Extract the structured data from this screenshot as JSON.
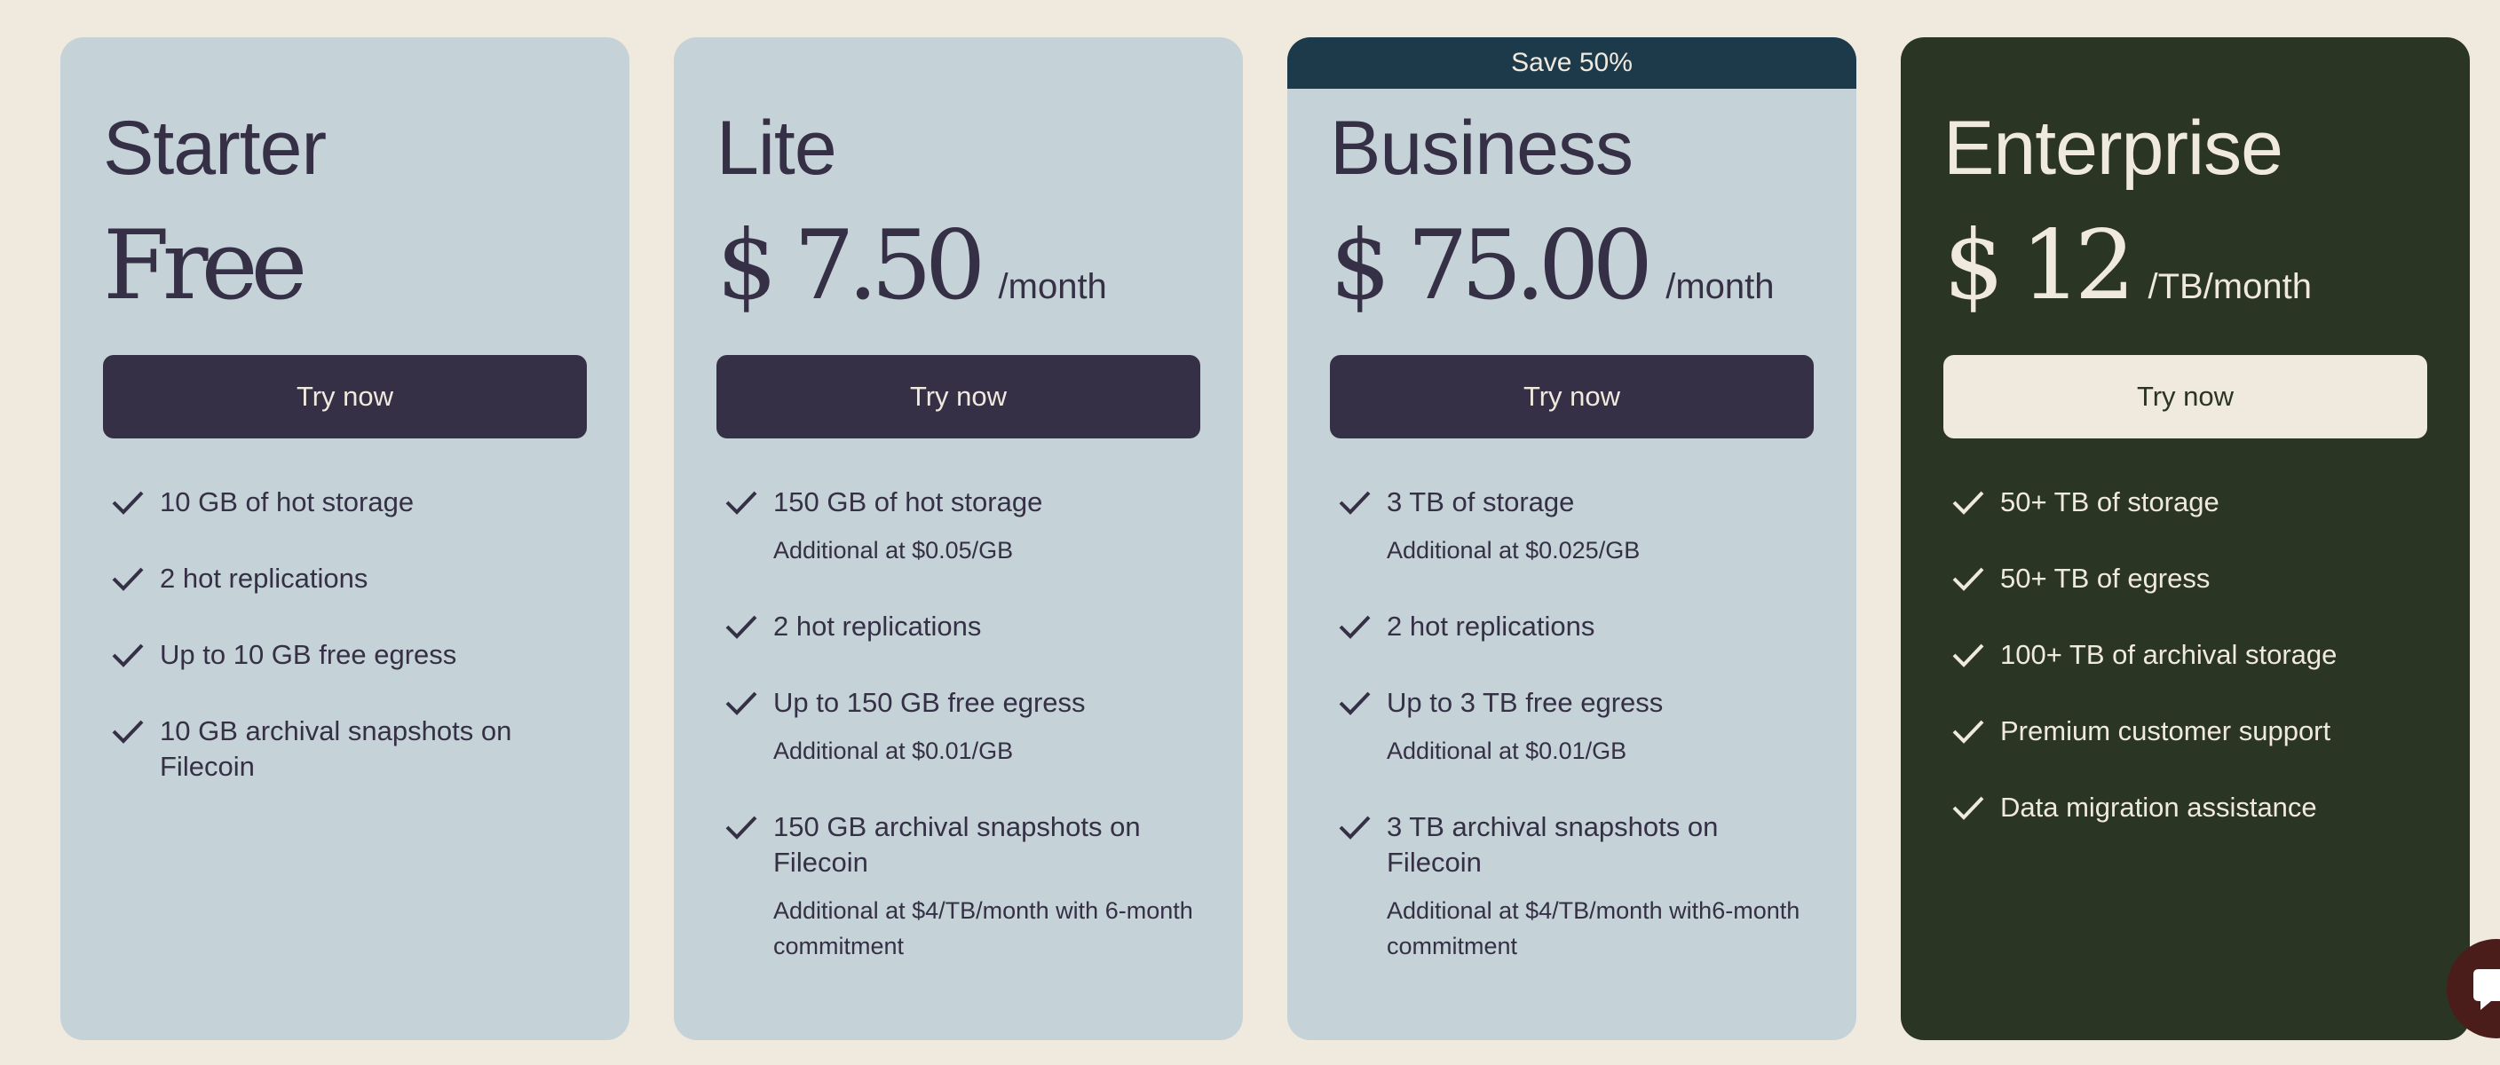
{
  "plans": [
    {
      "name": "Starter",
      "price": "Free",
      "period": "",
      "cta": "Try now",
      "features": [
        {
          "text": "10 GB of hot storage"
        },
        {
          "text": "2 hot replications"
        },
        {
          "text": "Up to 10 GB free egress"
        },
        {
          "text": "10 GB archival snapshots on Filecoin"
        }
      ]
    },
    {
      "name": "Lite",
      "price": "$ 7.50",
      "period": "/month",
      "cta": "Try now",
      "features": [
        {
          "text": "150 GB of hot storage",
          "note": "Additional at $0.05/GB"
        },
        {
          "text": "2 hot replications"
        },
        {
          "text": "Up to 150 GB free egress",
          "note": "Additional at $0.01/GB"
        },
        {
          "text": "150 GB archival snapshots on Filecoin",
          "note": "Additional at $4/TB/month with 6-month commitment"
        }
      ]
    },
    {
      "name": "Business",
      "badge": "Save 50%",
      "price": "$ 75.00",
      "period": "/month",
      "cta": "Try now",
      "features": [
        {
          "text": "3 TB of storage",
          "note": "Additional at $0.025/GB"
        },
        {
          "text": "2 hot replications"
        },
        {
          "text": "Up to 3 TB free egress",
          "note": "Additional at $0.01/GB"
        },
        {
          "text": "3 TB archival snapshots on Filecoin",
          "note": "Additional at $4/TB/month with6-month commitment"
        }
      ]
    },
    {
      "name": "Enterprise",
      "price": "$ 12",
      "period": "/TB/month",
      "cta": "Try now",
      "features": [
        {
          "text": "50+ TB of storage"
        },
        {
          "text": "50+ TB of egress"
        },
        {
          "text": "100+ TB of archival storage"
        },
        {
          "text": "Premium customer support"
        },
        {
          "text": "Data migration assistance"
        }
      ]
    }
  ],
  "icons": {
    "feature": "check-icon",
    "chat": "chat-icon"
  },
  "colors": {
    "page_background": "#f0e9de",
    "card_light": "#c5d2d8",
    "card_dark": "#2b3524",
    "ink": "#353045",
    "badge": "#1d3a4b",
    "chat_button": "#4a1d1a"
  }
}
